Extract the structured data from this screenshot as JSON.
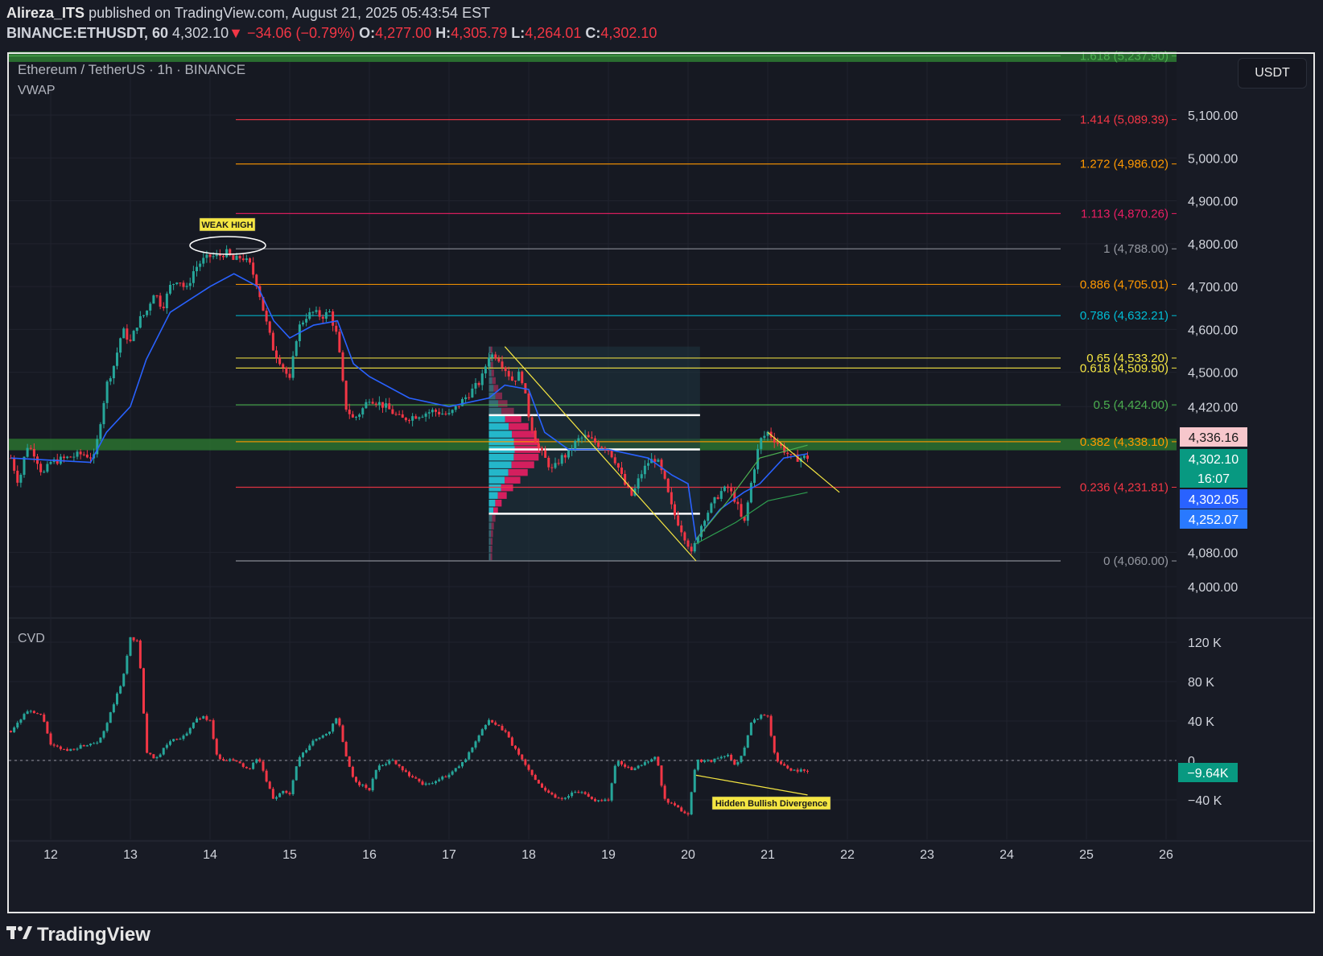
{
  "header": {
    "author": "Alireza_ITS",
    "published": "published on TradingView.com, August 21, 2025 05:43:54 EST",
    "symbol": "BINANCE:ETHUSDT, 60",
    "price": "4,302.10",
    "arrow": "▼",
    "change": "−34.06 (−0.79%)",
    "o_label": "O:",
    "o_value": "4,277.00",
    "h_label": "H:",
    "h_value": "4,305.79",
    "l_label": "L:",
    "l_value": "4,264.01",
    "c_label": "C:",
    "c_value": "4,302.10"
  },
  "legend": {
    "title": "Ethereum / TetherUS · 1h · BINANCE",
    "indicator": "VWAP",
    "cvd_label": "CVD"
  },
  "currency_button": "USDT",
  "annotations": {
    "weak_high": "WEAK HIGH",
    "divergence": "Hidden Bullish Divergence"
  },
  "price_badges": [
    {
      "text": "4,336.16",
      "bg": "#f7c7cc",
      "fg": "#1a1a1a",
      "value": 4336.16
    },
    {
      "text": "4,302.10",
      "bg": "#089981",
      "fg": "#ffffff",
      "value": 4302.1
    },
    {
      "text": "16:07",
      "bg": "#089981",
      "fg": "#ffffff",
      "value": 4302.1
    },
    {
      "text": "4,302.05",
      "bg": "#2962ff",
      "fg": "#ffffff",
      "value": 4302.05
    },
    {
      "text": "4,252.07",
      "bg": "#2979ff",
      "fg": "#ffffff",
      "value": 4252.07
    }
  ],
  "cvd_badge": {
    "text": "−9.64K",
    "bg": "#089981",
    "value": -9.64
  },
  "colors": {
    "background": "#181b25",
    "up": "#26a69a",
    "down": "#f23645",
    "vwap": "#2962ff",
    "trendline": "#f5e642",
    "zone": "#2e7d32"
  },
  "chart_data": {
    "type": "candlestick",
    "x_axis": {
      "type": "date",
      "ticks": [
        "12",
        "13",
        "14",
        "15",
        "16",
        "17",
        "18",
        "19",
        "20",
        "21",
        "22",
        "23",
        "24",
        "25",
        "26"
      ]
    },
    "y_axis": {
      "unit": "USDT",
      "range": [
        3950,
        5290
      ],
      "ticks": [
        {
          "label": "5,100.00",
          "value": 5100
        },
        {
          "label": "5,000.00",
          "value": 5000
        },
        {
          "label": "4,900.00",
          "value": 4900
        },
        {
          "label": "4,800.00",
          "value": 4800
        },
        {
          "label": "4,700.00",
          "value": 4700
        },
        {
          "label": "4,600.00",
          "value": 4600
        },
        {
          "label": "4,500.00",
          "value": 4500
        },
        {
          "label": "4,420.00",
          "value": 4420
        },
        {
          "label": "4,080.00",
          "value": 4080
        },
        {
          "label": "4,000.00",
          "value": 4000
        }
      ]
    },
    "fibonacci_levels": [
      {
        "label": "1.618 (5,237.90)",
        "value": 5237.9,
        "color": "#4caf50"
      },
      {
        "label": "1.414 (5,089.39)",
        "value": 5089.39,
        "color": "#f23645"
      },
      {
        "label": "1.272 (4,986.02)",
        "value": 4986.02,
        "color": "#ff9800"
      },
      {
        "label": "1.113 (4,870.26)",
        "value": 4870.26,
        "color": "#e91e63"
      },
      {
        "label": "1 (4,788.00)",
        "value": 4788.0,
        "color": "#9598a1"
      },
      {
        "label": "0.886 (4,705.01)",
        "value": 4705.01,
        "color": "#ff9800"
      },
      {
        "label": "0.786 (4,632.21)",
        "value": 4632.21,
        "color": "#00bcd4"
      },
      {
        "label": "0.65 (4,533.20)",
        "value": 4533.2,
        "color": "#f5e642"
      },
      {
        "label": "0.618 (4,509.90)",
        "value": 4509.9,
        "color": "#f5e642"
      },
      {
        "label": "0.5 (4,424.00)",
        "value": 4424.0,
        "color": "#4caf50"
      },
      {
        "label": "0.382 (4,338.10)",
        "value": 4338.1,
        "color": "#ff9800"
      },
      {
        "label": "0.236 (4,231.81)",
        "value": 4231.81,
        "color": "#f23645"
      },
      {
        "label": "0 (4,060.00)",
        "value": 4060.0,
        "color": "#9598a1"
      }
    ],
    "price_path": [
      [
        11.5,
        4300
      ],
      [
        11.6,
        4240
      ],
      [
        11.7,
        4330
      ],
      [
        11.8,
        4310
      ],
      [
        11.9,
        4260
      ],
      [
        12.0,
        4290
      ],
      [
        12.2,
        4300
      ],
      [
        12.4,
        4310
      ],
      [
        12.55,
        4300
      ],
      [
        12.6,
        4360
      ],
      [
        12.7,
        4470
      ],
      [
        12.8,
        4520
      ],
      [
        12.9,
        4600
      ],
      [
        13.0,
        4570
      ],
      [
        13.1,
        4620
      ],
      [
        13.2,
        4640
      ],
      [
        13.3,
        4690
      ],
      [
        13.4,
        4650
      ],
      [
        13.5,
        4700
      ],
      [
        13.6,
        4720
      ],
      [
        13.7,
        4690
      ],
      [
        13.8,
        4740
      ],
      [
        13.9,
        4760
      ],
      [
        14.0,
        4770
      ],
      [
        14.1,
        4770
      ],
      [
        14.2,
        4780
      ],
      [
        14.3,
        4760
      ],
      [
        14.4,
        4770
      ],
      [
        14.5,
        4750
      ],
      [
        14.6,
        4700
      ],
      [
        14.7,
        4620
      ],
      [
        14.8,
        4550
      ],
      [
        14.9,
        4520
      ],
      [
        15.0,
        4480
      ],
      [
        15.1,
        4600
      ],
      [
        15.2,
        4630
      ],
      [
        15.3,
        4640
      ],
      [
        15.4,
        4630
      ],
      [
        15.5,
        4640
      ],
      [
        15.6,
        4580
      ],
      [
        15.7,
        4420
      ],
      [
        15.8,
        4390
      ],
      [
        15.9,
        4410
      ],
      [
        16.0,
        4440
      ],
      [
        16.2,
        4420
      ],
      [
        16.4,
        4390
      ],
      [
        16.6,
        4400
      ],
      [
        16.8,
        4410
      ],
      [
        17.0,
        4400
      ],
      [
        17.2,
        4440
      ],
      [
        17.4,
        4480
      ],
      [
        17.5,
        4540
      ],
      [
        17.6,
        4540
      ],
      [
        17.7,
        4510
      ],
      [
        17.8,
        4480
      ],
      [
        17.9,
        4500
      ],
      [
        18.0,
        4400
      ],
      [
        18.1,
        4330
      ],
      [
        18.2,
        4300
      ],
      [
        18.3,
        4270
      ],
      [
        18.4,
        4300
      ],
      [
        18.5,
        4310
      ],
      [
        18.6,
        4340
      ],
      [
        18.7,
        4350
      ],
      [
        18.8,
        4340
      ],
      [
        18.9,
        4330
      ],
      [
        19.0,
        4320
      ],
      [
        19.1,
        4290
      ],
      [
        19.2,
        4240
      ],
      [
        19.3,
        4210
      ],
      [
        19.4,
        4260
      ],
      [
        19.5,
        4290
      ],
      [
        19.6,
        4300
      ],
      [
        19.7,
        4250
      ],
      [
        19.8,
        4180
      ],
      [
        19.9,
        4140
      ],
      [
        20.0,
        4100
      ],
      [
        20.05,
        4070
      ],
      [
        20.1,
        4110
      ],
      [
        20.2,
        4160
      ],
      [
        20.3,
        4190
      ],
      [
        20.4,
        4220
      ],
      [
        20.5,
        4230
      ],
      [
        20.6,
        4200
      ],
      [
        20.7,
        4140
      ],
      [
        20.8,
        4250
      ],
      [
        20.9,
        4340
      ],
      [
        21.0,
        4360
      ],
      [
        21.1,
        4340
      ],
      [
        21.2,
        4320
      ],
      [
        21.3,
        4300
      ],
      [
        21.4,
        4300
      ],
      [
        21.5,
        4302
      ]
    ],
    "vwap_path": [
      [
        11.5,
        4300
      ],
      [
        12.5,
        4290
      ],
      [
        12.7,
        4360
      ],
      [
        13.0,
        4420
      ],
      [
        13.2,
        4530
      ],
      [
        13.5,
        4640
      ],
      [
        14.0,
        4700
      ],
      [
        14.3,
        4730
      ],
      [
        14.6,
        4700
      ],
      [
        14.8,
        4620
      ],
      [
        15.0,
        4580
      ],
      [
        15.3,
        4610
      ],
      [
        15.6,
        4620
      ],
      [
        15.8,
        4520
      ],
      [
        16.0,
        4490
      ],
      [
        16.5,
        4440
      ],
      [
        17.0,
        4420
      ],
      [
        17.5,
        4440
      ],
      [
        17.7,
        4470
      ],
      [
        18.0,
        4460
      ],
      [
        18.2,
        4360
      ],
      [
        18.5,
        4320
      ],
      [
        19.0,
        4320
      ],
      [
        19.5,
        4300
      ],
      [
        19.8,
        4260
      ],
      [
        20.0,
        4240
      ],
      [
        20.1,
        4110
      ],
      [
        20.4,
        4180
      ],
      [
        20.7,
        4220
      ],
      [
        20.9,
        4240
      ],
      [
        21.2,
        4300
      ],
      [
        21.5,
        4310
      ]
    ],
    "trendlines": [
      {
        "from": [
          17.7,
          4560
        ],
        "to": [
          20.1,
          4060
        ]
      },
      {
        "from": [
          21.0,
          4360
        ],
        "to": [
          21.9,
          4220
        ]
      }
    ],
    "support_zone": [
      4318,
      4345
    ],
    "top_zone": [
      5224,
      5248
    ],
    "volume_profile": {
      "x_start": 17.5,
      "x_end": 20.15,
      "price_low": 4060,
      "price_high": 4560,
      "value_area": {
        "high": 4400,
        "poc": 4320,
        "low": 4170
      }
    },
    "cvd": {
      "y_ticks": [
        {
          "label": "120 K",
          "value": 120
        },
        {
          "label": "80 K",
          "value": 80
        },
        {
          "label": "40 K",
          "value": 40
        },
        {
          "label": "0",
          "value": 0
        },
        {
          "label": "−40 K",
          "value": -40
        }
      ],
      "y_range": [
        -60,
        140
      ],
      "unit": "K",
      "path": [
        [
          11.5,
          30
        ],
        [
          11.7,
          50
        ],
        [
          11.9,
          45
        ],
        [
          12.0,
          15
        ],
        [
          12.2,
          10
        ],
        [
          12.4,
          15
        ],
        [
          12.6,
          20
        ],
        [
          12.7,
          35
        ],
        [
          12.8,
          60
        ],
        [
          12.9,
          80
        ],
        [
          13.0,
          125
        ],
        [
          13.1,
          120
        ],
        [
          13.2,
          10
        ],
        [
          13.3,
          0
        ],
        [
          13.5,
          20
        ],
        [
          13.7,
          25
        ],
        [
          13.8,
          40
        ],
        [
          13.9,
          45
        ],
        [
          14.0,
          40
        ],
        [
          14.1,
          0
        ],
        [
          14.3,
          0
        ],
        [
          14.5,
          -10
        ],
        [
          14.6,
          5
        ],
        [
          14.7,
          -20
        ],
        [
          14.8,
          -40
        ],
        [
          14.9,
          -30
        ],
        [
          15.0,
          -35
        ],
        [
          15.1,
          0
        ],
        [
          15.3,
          20
        ],
        [
          15.5,
          30
        ],
        [
          15.6,
          45
        ],
        [
          15.7,
          5
        ],
        [
          15.8,
          -20
        ],
        [
          16.0,
          -30
        ],
        [
          16.1,
          -5
        ],
        [
          16.3,
          0
        ],
        [
          16.5,
          -15
        ],
        [
          16.7,
          -25
        ],
        [
          17.0,
          -15
        ],
        [
          17.2,
          0
        ],
        [
          17.4,
          30
        ],
        [
          17.5,
          40
        ],
        [
          17.7,
          30
        ],
        [
          17.8,
          15
        ],
        [
          18.0,
          -10
        ],
        [
          18.2,
          -30
        ],
        [
          18.4,
          -40
        ],
        [
          18.6,
          -30
        ],
        [
          18.8,
          -40
        ],
        [
          19.0,
          -40
        ],
        [
          19.1,
          0
        ],
        [
          19.3,
          -10
        ],
        [
          19.5,
          0
        ],
        [
          19.6,
          5
        ],
        [
          19.7,
          -40
        ],
        [
          19.8,
          -45
        ],
        [
          20.0,
          -55
        ],
        [
          20.1,
          0
        ],
        [
          20.3,
          0
        ],
        [
          20.5,
          5
        ],
        [
          20.6,
          -5
        ],
        [
          20.7,
          10
        ],
        [
          20.8,
          40
        ],
        [
          20.9,
          45
        ],
        [
          21.0,
          45
        ],
        [
          21.1,
          0
        ],
        [
          21.3,
          -10
        ],
        [
          21.5,
          -10
        ]
      ],
      "divergence_line": {
        "from": [
          20.1,
          -15
        ],
        "to": [
          21.5,
          -35
        ]
      }
    }
  }
}
